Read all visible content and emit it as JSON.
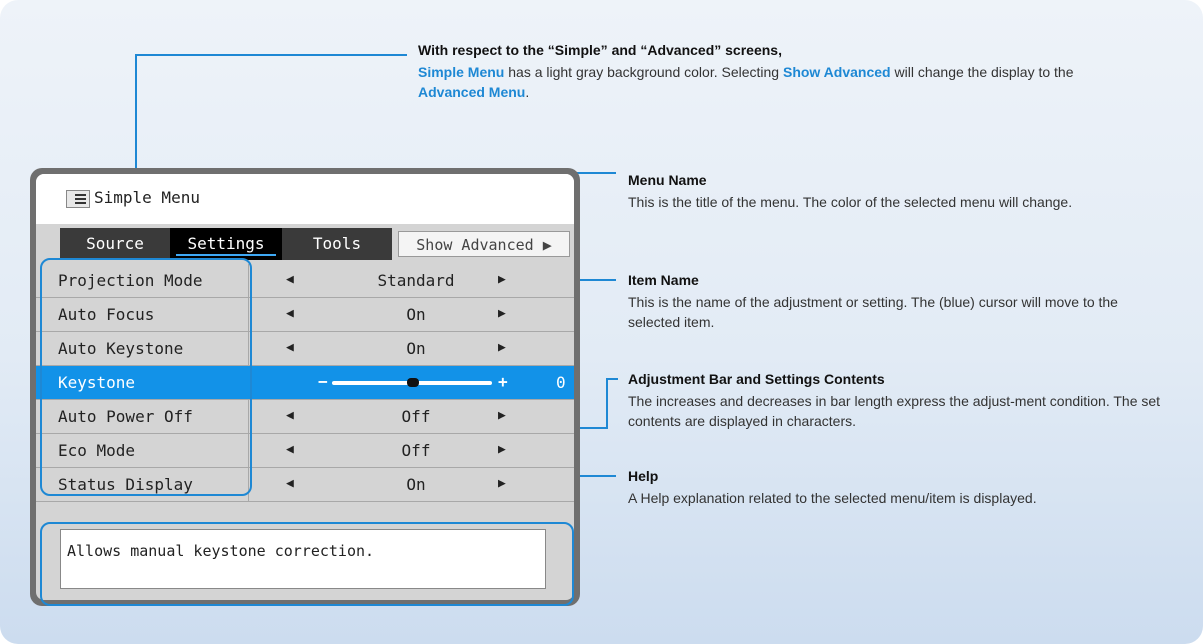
{
  "top_callout": {
    "title": "With respect to the “Simple” and “Advanced” screens,",
    "part1": "Simple Menu",
    "part2": " has a light gray background color. Selecting ",
    "part3": "Show Advanced",
    "part4": " will change the display to the ",
    "part5": "Advanced Menu",
    "part6": "."
  },
  "menu": {
    "name": "Simple Menu",
    "tabs": [
      "Source",
      "Settings",
      "Tools"
    ],
    "active_tab": "Settings",
    "show_advanced": "Show Advanced ▶",
    "rows": [
      {
        "name": "Projection Mode",
        "value": "Standard"
      },
      {
        "name": "Auto Focus",
        "value": "On"
      },
      {
        "name": "Auto Keystone",
        "value": "On"
      },
      {
        "name": "Keystone",
        "value": "0",
        "slider": true,
        "minus": "−",
        "plus": "+"
      },
      {
        "name": "Auto Power Off",
        "value": "Off"
      },
      {
        "name": "Eco Mode",
        "value": "Off"
      },
      {
        "name": "Status Display",
        "value": "On"
      }
    ],
    "left_arrow": "◀",
    "right_arrow": "▶",
    "help_text": "Allows manual keystone correction."
  },
  "callouts": [
    {
      "title": "Menu Name",
      "body": "This is the title of the menu. The color of the selected menu will change."
    },
    {
      "title": "Item Name",
      "body": "This is the name of the adjustment or setting. The (blue) cursor will move to the selected item."
    },
    {
      "title": "Adjustment Bar and Settings Contents",
      "body": "The increases and decreases in bar length express the adjust-ment condition. The set contents are displayed in characters."
    },
    {
      "title": "Help",
      "body": "A Help explanation related to the selected menu/item is displayed."
    }
  ],
  "colors": {
    "accent": "#1e88d4",
    "selected_row": "#1292e8"
  }
}
